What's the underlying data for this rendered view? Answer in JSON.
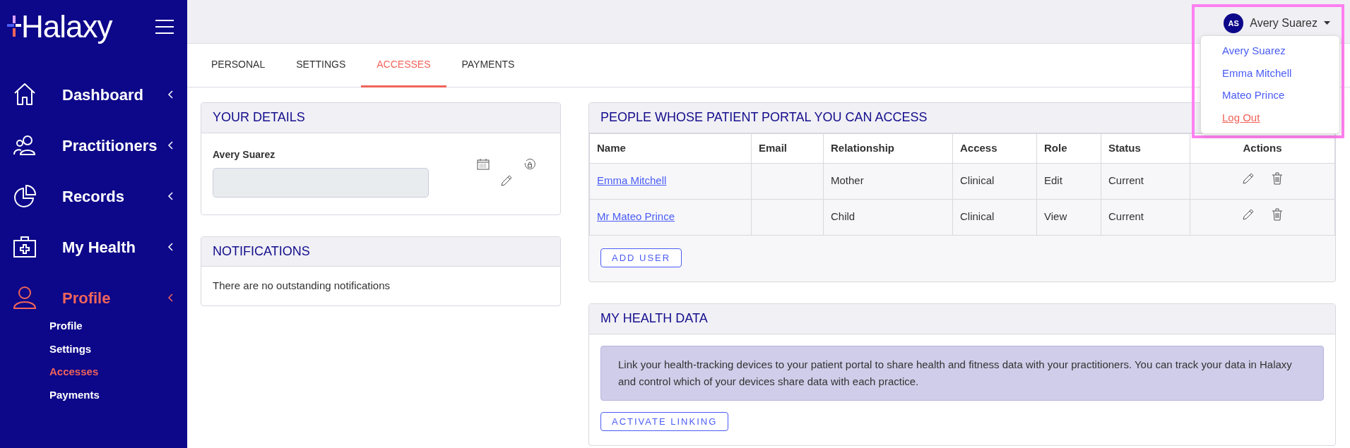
{
  "logo": "Halaxy",
  "sidebar": {
    "items": [
      {
        "label": "Dashboard",
        "selected": false
      },
      {
        "label": "Practitioners",
        "selected": false
      },
      {
        "label": "Records",
        "selected": false
      },
      {
        "label": "My Health",
        "selected": false
      },
      {
        "label": "Profile",
        "selected": true,
        "children": [
          {
            "label": "Profile",
            "selected": false
          },
          {
            "label": "Settings",
            "selected": false
          },
          {
            "label": "Accesses",
            "selected": true
          },
          {
            "label": "Payments",
            "selected": false
          }
        ]
      }
    ]
  },
  "user_menu": {
    "initials": "AS",
    "name": "Avery Suarez",
    "items": [
      {
        "label": "Avery Suarez",
        "kind": "account"
      },
      {
        "label": "Emma Mitchell",
        "kind": "account"
      },
      {
        "label": "Mateo Prince",
        "kind": "account"
      },
      {
        "label": "Log Out",
        "kind": "logout"
      }
    ]
  },
  "tabs": [
    {
      "label": "PERSONAL",
      "selected": false
    },
    {
      "label": "SETTINGS",
      "selected": false
    },
    {
      "label": "ACCESSES",
      "selected": true
    },
    {
      "label": "PAYMENTS",
      "selected": false
    }
  ],
  "your_details": {
    "title": "YOUR DETAILS",
    "name": "Avery Suarez"
  },
  "notifications": {
    "title": "NOTIFICATIONS",
    "message": "There are no outstanding notifications"
  },
  "people": {
    "title": "PEOPLE WHOSE PATIENT PORTAL YOU CAN ACCESS",
    "columns": [
      "Name",
      "Email",
      "Relationship",
      "Access",
      "Role",
      "Status",
      "Actions"
    ],
    "rows": [
      {
        "name": "Emma Mitchell",
        "relationship": "Mother",
        "access": "Clinical",
        "role": "Edit",
        "status": "Current"
      },
      {
        "name": "Mr Mateo Prince",
        "relationship": "Child",
        "access": "Clinical",
        "role": "View",
        "status": "Current"
      }
    ],
    "button": "ADD USER"
  },
  "health_data": {
    "title": "MY HEALTH DATA",
    "info": "Link your health-tracking devices to your patient portal to share health and fitness data with your practitioners. You can track your data in Halaxy and control which of your devices share data with each practice.",
    "button": "ACTIVATE LINKING"
  }
}
